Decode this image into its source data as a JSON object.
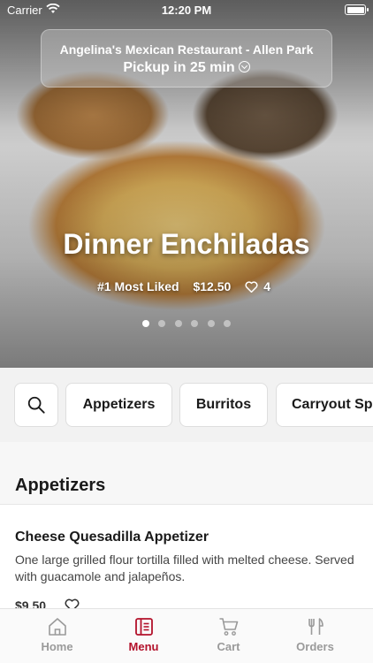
{
  "status_bar": {
    "carrier": "Carrier",
    "time": "12:20 PM"
  },
  "pickup": {
    "restaurant": "Angelina's Mexican Restaurant - Allen Park",
    "pickup_time": "Pickup in 25 min"
  },
  "featured": {
    "title": "Dinner Enchiladas",
    "badge": "#1 Most Liked",
    "price": "$12.50",
    "likes": "4",
    "slides_total": 6,
    "active_slide": 1
  },
  "categories": [
    "Appetizers",
    "Burritos",
    "Carryout Sp"
  ],
  "section": {
    "title": "Appetizers"
  },
  "items": [
    {
      "name": "Cheese Quesadilla Appetizer",
      "description": "One large grilled flour tortilla filled with melted cheese. Served with guacamole and jalapeños.",
      "price": "$9.50"
    }
  ],
  "tabs": [
    {
      "label": "Home",
      "icon": "home-icon"
    },
    {
      "label": "Menu",
      "icon": "menu-icon"
    },
    {
      "label": "Cart",
      "icon": "cart-icon"
    },
    {
      "label": "Orders",
      "icon": "utensils-icon"
    }
  ],
  "colors": {
    "accent": "#b3122b",
    "inactive_tab": "#9a9a9a"
  }
}
